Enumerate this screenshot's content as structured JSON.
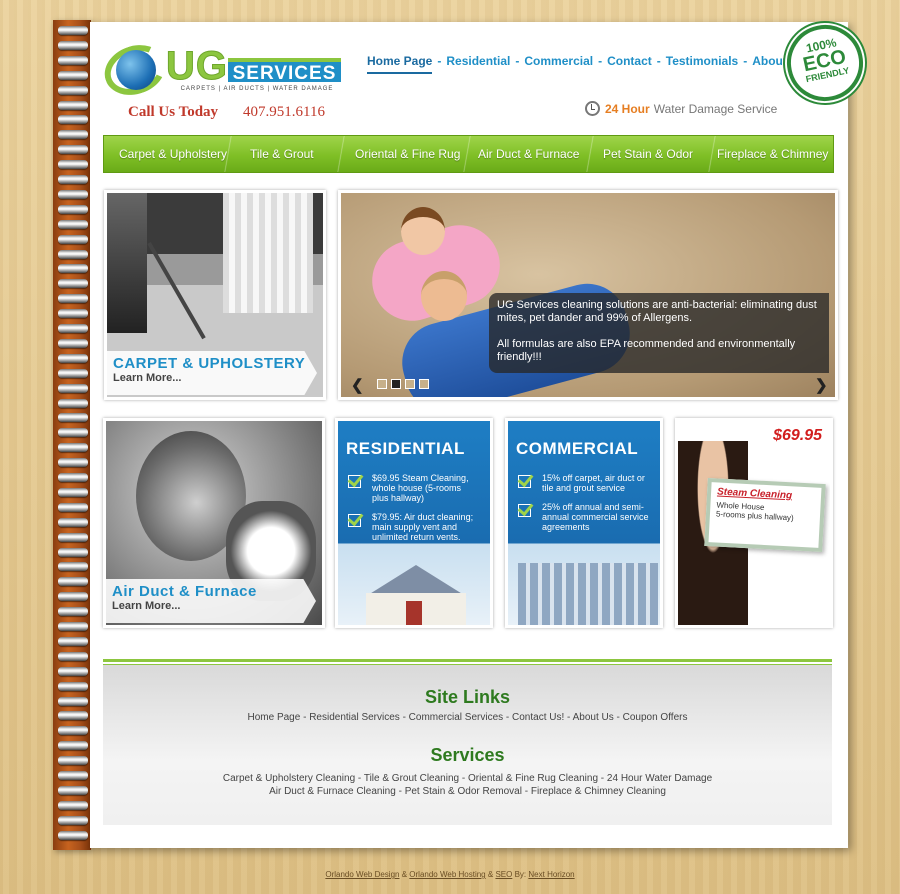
{
  "brand": {
    "logo_main": "UG",
    "logo_services": "SERVICES",
    "logo_sub": "CARPETS | AIR DUCTS | WATER DAMAGE"
  },
  "contact": {
    "call_label": "Call Us Today",
    "phone": "407.951.6116",
    "hours_highlight": "24 Hour",
    "hours_rest": "Water Damage Service"
  },
  "eco_badge": {
    "pct": "100%",
    "word": "ECO",
    "sub": "FRIENDLY"
  },
  "top_nav": [
    "Home Page",
    "Residential",
    "Commercial",
    "Contact",
    "Testimonials",
    "About Us"
  ],
  "service_menu": [
    "Carpet & Upholstery",
    "Tile & Grout",
    "Oriental & Fine Rug",
    "Air Duct & Furnace",
    "Pet Stain & Odor",
    "Fireplace & Chimney"
  ],
  "feature_carpet": {
    "title": "CARPET & UPHOLSTERY",
    "more": "Learn More..."
  },
  "slider": {
    "caption_1": "UG Services cleaning solutions are anti-bacterial: eliminating dust mites, pet dander and 99% of Allergens.",
    "caption_2": "All formulas are also EPA recommended and environmentally friendly!!!",
    "prev": "❮",
    "next": "❯"
  },
  "feature_airduct": {
    "title": "Air Duct & Furnace",
    "more": "Learn More..."
  },
  "residential": {
    "title": "RESIDENTIAL",
    "items": [
      "$69.95 Steam Cleaning, whole house (5-rooms plus hallway)",
      "$79.95: Air duct cleaning; main supply vent and unlimited return vents."
    ]
  },
  "commercial": {
    "title": "COMMERCIAL",
    "items": [
      "15% off carpet, air duct or tile and grout service",
      "25% off annual and semi-annual commercial service agreements"
    ]
  },
  "coupon": {
    "price": "$69.95",
    "title": "Steam Cleaning",
    "line1": "Whole House",
    "line2": "5-rooms plus hallway)"
  },
  "footer": {
    "site_links_title": "Site Links",
    "site_links": "Home Page  -  Residential Services  -  Commercial Services  -  Contact Us!  -  About Us  -  Coupon Offers",
    "services_title": "Services",
    "services_line1": "Carpet & Upholstery Cleaning  -  Tile & Grout Cleaning  -  Oriental & Fine Rug Cleaning  -  24 Hour Water Damage",
    "services_line2": "Air Duct & Furnace Cleaning - Pet Stain & Odor Removal - Fireplace & Chimney Cleaning"
  },
  "credits": {
    "a": "Orlando Web Design",
    "amp1": "&",
    "b": "Orlando Web Hosting",
    "amp2": "&",
    "c": "SEO",
    "by": "By:",
    "d": "Next Horizon"
  }
}
